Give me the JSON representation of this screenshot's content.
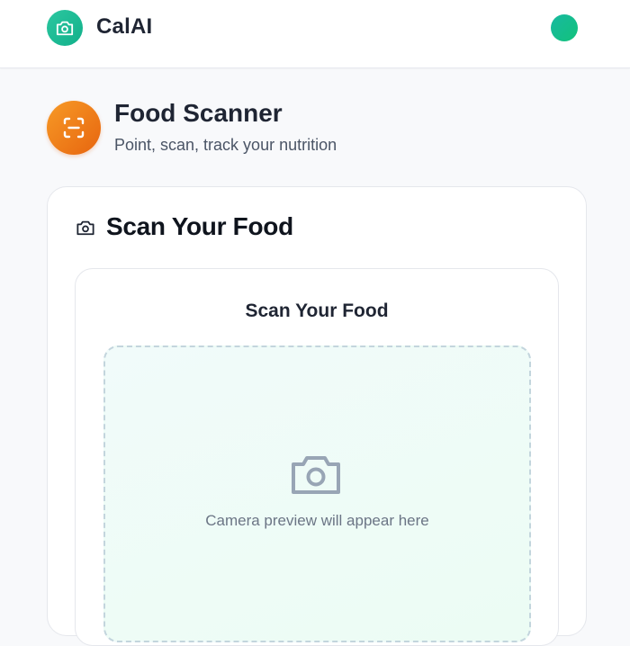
{
  "header": {
    "app_name": "CalAI",
    "logo_icon": "camera-icon",
    "avatar_icon": "avatar"
  },
  "page": {
    "title": "Food Scanner",
    "subtitle": "Point, scan, track your nutrition",
    "badge_icon": "scan-frame-icon"
  },
  "scan_card": {
    "title": "Scan Your Food",
    "title_icon": "camera-icon",
    "inner_title": "Scan Your Food",
    "preview_icon": "camera-icon",
    "preview_placeholder": "Camera preview will appear here"
  },
  "colors": {
    "brand_green": "#1fbf96",
    "scanner_orange": "#f08a1c",
    "preview_bg": "#eefcf6"
  }
}
